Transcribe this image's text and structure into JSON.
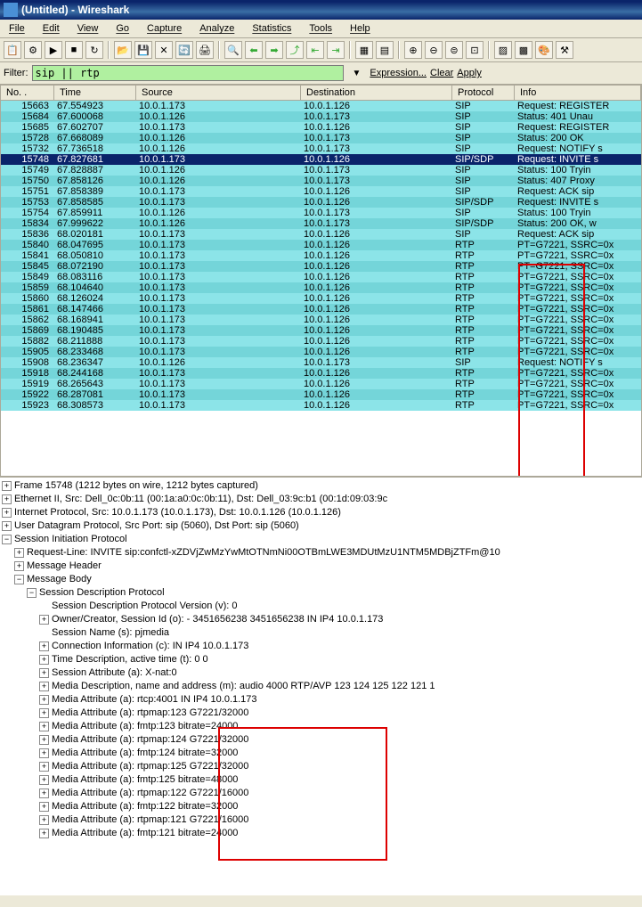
{
  "window": {
    "title": "(Untitled) - Wireshark"
  },
  "menu": {
    "file": "File",
    "edit": "Edit",
    "view": "View",
    "go": "Go",
    "capture": "Capture",
    "analyze": "Analyze",
    "statistics": "Statistics",
    "tools": "Tools",
    "help": "Help"
  },
  "filter": {
    "label": "Filter:",
    "value": "sip || rtp",
    "expression": "Expression...",
    "clear": "Clear",
    "apply": "Apply"
  },
  "columns": {
    "no": "No. .",
    "time": "Time",
    "source": "Source",
    "destination": "Destination",
    "protocol": "Protocol",
    "info": "Info"
  },
  "packets": [
    {
      "no": "15663",
      "time": "67.554923",
      "src": "10.0.1.173",
      "dst": "10.0.1.126",
      "proto": "SIP",
      "info": "Request: REGISTER"
    },
    {
      "no": "15684",
      "time": "67.600068",
      "src": "10.0.1.126",
      "dst": "10.0.1.173",
      "proto": "SIP",
      "info": "Status: 401 Unau"
    },
    {
      "no": "15685",
      "time": "67.602707",
      "src": "10.0.1.173",
      "dst": "10.0.1.126",
      "proto": "SIP",
      "info": "Request: REGISTER"
    },
    {
      "no": "15728",
      "time": "67.668089",
      "src": "10.0.1.126",
      "dst": "10.0.1.173",
      "proto": "SIP",
      "info": "Status: 200 OK"
    },
    {
      "no": "15732",
      "time": "67.736518",
      "src": "10.0.1.126",
      "dst": "10.0.1.173",
      "proto": "SIP",
      "info": "Request: NOTIFY s"
    },
    {
      "no": "15748",
      "time": "67.827681",
      "src": "10.0.1.173",
      "dst": "10.0.1.126",
      "proto": "SIP/SDP",
      "info": "Request: INVITE s",
      "sel": true
    },
    {
      "no": "15749",
      "time": "67.828887",
      "src": "10.0.1.126",
      "dst": "10.0.1.173",
      "proto": "SIP",
      "info": "Status: 100 Tryin"
    },
    {
      "no": "15750",
      "time": "67.858126",
      "src": "10.0.1.126",
      "dst": "10.0.1.173",
      "proto": "SIP",
      "info": "Status: 407 Proxy"
    },
    {
      "no": "15751",
      "time": "67.858389",
      "src": "10.0.1.173",
      "dst": "10.0.1.126",
      "proto": "SIP",
      "info": "Request: ACK sip"
    },
    {
      "no": "15753",
      "time": "67.858585",
      "src": "10.0.1.173",
      "dst": "10.0.1.126",
      "proto": "SIP/SDP",
      "info": "Request: INVITE s"
    },
    {
      "no": "15754",
      "time": "67.859911",
      "src": "10.0.1.126",
      "dst": "10.0.1.173",
      "proto": "SIP",
      "info": "Status: 100 Tryin"
    },
    {
      "no": "15834",
      "time": "67.999622",
      "src": "10.0.1.126",
      "dst": "10.0.1.173",
      "proto": "SIP/SDP",
      "info": "Status: 200 OK, w"
    },
    {
      "no": "15836",
      "time": "68.020181",
      "src": "10.0.1.173",
      "dst": "10.0.1.126",
      "proto": "SIP",
      "info": "Request: ACK sip"
    },
    {
      "no": "15840",
      "time": "68.047695",
      "src": "10.0.1.173",
      "dst": "10.0.1.126",
      "proto": "RTP",
      "info": "PT=G7221, SSRC=0x"
    },
    {
      "no": "15841",
      "time": "68.050810",
      "src": "10.0.1.173",
      "dst": "10.0.1.126",
      "proto": "RTP",
      "info": "PT=G7221, SSRC=0x"
    },
    {
      "no": "15845",
      "time": "68.072190",
      "src": "10.0.1.173",
      "dst": "10.0.1.126",
      "proto": "RTP",
      "info": "PT=G7221, SSRC=0x"
    },
    {
      "no": "15849",
      "time": "68.083116",
      "src": "10.0.1.173",
      "dst": "10.0.1.126",
      "proto": "RTP",
      "info": "PT=G7221, SSRC=0x"
    },
    {
      "no": "15859",
      "time": "68.104640",
      "src": "10.0.1.173",
      "dst": "10.0.1.126",
      "proto": "RTP",
      "info": "PT=G7221, SSRC=0x"
    },
    {
      "no": "15860",
      "time": "68.126024",
      "src": "10.0.1.173",
      "dst": "10.0.1.126",
      "proto": "RTP",
      "info": "PT=G7221, SSRC=0x"
    },
    {
      "no": "15861",
      "time": "68.147466",
      "src": "10.0.1.173",
      "dst": "10.0.1.126",
      "proto": "RTP",
      "info": "PT=G7221, SSRC=0x"
    },
    {
      "no": "15862",
      "time": "68.168941",
      "src": "10.0.1.173",
      "dst": "10.0.1.126",
      "proto": "RTP",
      "info": "PT=G7221, SSRC=0x"
    },
    {
      "no": "15869",
      "time": "68.190485",
      "src": "10.0.1.173",
      "dst": "10.0.1.126",
      "proto": "RTP",
      "info": "PT=G7221, SSRC=0x"
    },
    {
      "no": "15882",
      "time": "68.211888",
      "src": "10.0.1.173",
      "dst": "10.0.1.126",
      "proto": "RTP",
      "info": "PT=G7221, SSRC=0x"
    },
    {
      "no": "15905",
      "time": "68.233468",
      "src": "10.0.1.173",
      "dst": "10.0.1.126",
      "proto": "RTP",
      "info": "PT=G7221, SSRC=0x"
    },
    {
      "no": "15908",
      "time": "68.236347",
      "src": "10.0.1.126",
      "dst": "10.0.1.173",
      "proto": "SIP",
      "info": "Request: NOTIFY s"
    },
    {
      "no": "15918",
      "time": "68.244168",
      "src": "10.0.1.173",
      "dst": "10.0.1.126",
      "proto": "RTP",
      "info": "PT=G7221, SSRC=0x"
    },
    {
      "no": "15919",
      "time": "68.265643",
      "src": "10.0.1.173",
      "dst": "10.0.1.126",
      "proto": "RTP",
      "info": "PT=G7221, SSRC=0x"
    },
    {
      "no": "15922",
      "time": "68.287081",
      "src": "10.0.1.173",
      "dst": "10.0.1.126",
      "proto": "RTP",
      "info": "PT=G7221, SSRC=0x"
    },
    {
      "no": "15923",
      "time": "68.308573",
      "src": "10.0.1.173",
      "dst": "10.0.1.126",
      "proto": "RTP",
      "info": "PT=G7221, SSRC=0x"
    }
  ],
  "details": {
    "frame": "Frame 15748 (1212 bytes on wire, 1212 bytes captured)",
    "eth": "Ethernet II, Src: Dell_0c:0b:11 (00:1a:a0:0c:0b:11), Dst: Dell_03:9c:b1 (00:1d:09:03:9c",
    "ip": "Internet Protocol, Src: 10.0.1.173 (10.0.1.173), Dst: 10.0.1.126 (10.0.1.126)",
    "udp": "User Datagram Protocol, Src Port: sip (5060), Dst Port: sip (5060)",
    "sip": "Session Initiation Protocol",
    "reqline": "Request-Line: INVITE sip:confctl-xZDVjZwMzYwMtOTNmNi00OTBmLWE3MDUtMzU1NTM5MDBjZTFm@10",
    "msgheader": "Message Header",
    "msgbody": "Message Body",
    "sdp": "Session Description Protocol",
    "sdp_v": "Session Description Protocol Version (v): 0",
    "sdp_o": "Owner/Creator, Session Id (o): - 3451656238 3451656238 IN IP4 10.0.1.173",
    "sdp_s": "Session Name (s): pjmedia",
    "sdp_c": "Connection Information (c): IN IP4 10.0.1.173",
    "sdp_t": "Time Description, active time (t): 0 0",
    "sdp_a1": "Session Attribute (a): X-nat:0",
    "sdp_m": "Media Description, name and address (m): audio 4000 RTP/AVP 123 124 125 122 121 1",
    "sdp_rtcp": "Media Attribute (a): rtcp:4001 IN IP4 10.0.1.173",
    "ma1": "Media Attribute (a): rtpmap:123 G7221/32000",
    "ma2": "Media Attribute (a): fmtp:123 bitrate=24000",
    "ma3": "Media Attribute (a): rtpmap:124 G7221/32000",
    "ma4": "Media Attribute (a): fmtp:124 bitrate=32000",
    "ma5": "Media Attribute (a): rtpmap:125 G7221/32000",
    "ma6": "Media Attribute (a): fmtp:125 bitrate=48000",
    "ma7": "Media Attribute (a): rtpmap:122 G7221/16000",
    "ma8": "Media Attribute (a): fmtp:122 bitrate=32000",
    "ma9": "Media Attribute (a): rtpmap:121 G7221/16000",
    "ma10": "Media Attribute (a): fmtp:121 bitrate=24000"
  }
}
